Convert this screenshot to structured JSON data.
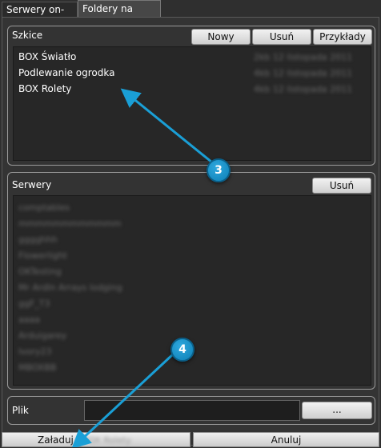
{
  "tabs": [
    {
      "label": "Serwery on-line"
    },
    {
      "label": "Foldery na dysku"
    }
  ],
  "sketches": {
    "title": "Szkice",
    "new_label": "Nowy",
    "delete_label": "Usuń",
    "examples_label": "Przykłady",
    "items": [
      {
        "name": "BOX Światło",
        "meta": "2kb   12 listopada 2011"
      },
      {
        "name": "Podlewanie ogrodka",
        "meta": "4kb   12 listopada 2011"
      },
      {
        "name": "BOX Rolety",
        "meta": "4kb   12 listopada 2011"
      }
    ]
  },
  "servers": {
    "title": "Serwery",
    "delete_label": "Usuń",
    "items": [
      "comptables",
      "mmmmmmmmmmmm",
      "gggghhh",
      "Flowerlight",
      "OKTesting",
      "Mr ArdIn Arrays lodging",
      "ggF_T3",
      "aaaa",
      "Arduigarey",
      "Ivory23",
      "MBOXBB"
    ]
  },
  "file": {
    "label": "Plik",
    "value": "",
    "browse_label": "..."
  },
  "bottom": {
    "load_label": "Załaduj",
    "load_hint": "BOX Rolety",
    "cancel_label": "Anuluj"
  },
  "annotations": {
    "badge3": "3",
    "badge4": "4",
    "accent": "#1a9fd6"
  }
}
